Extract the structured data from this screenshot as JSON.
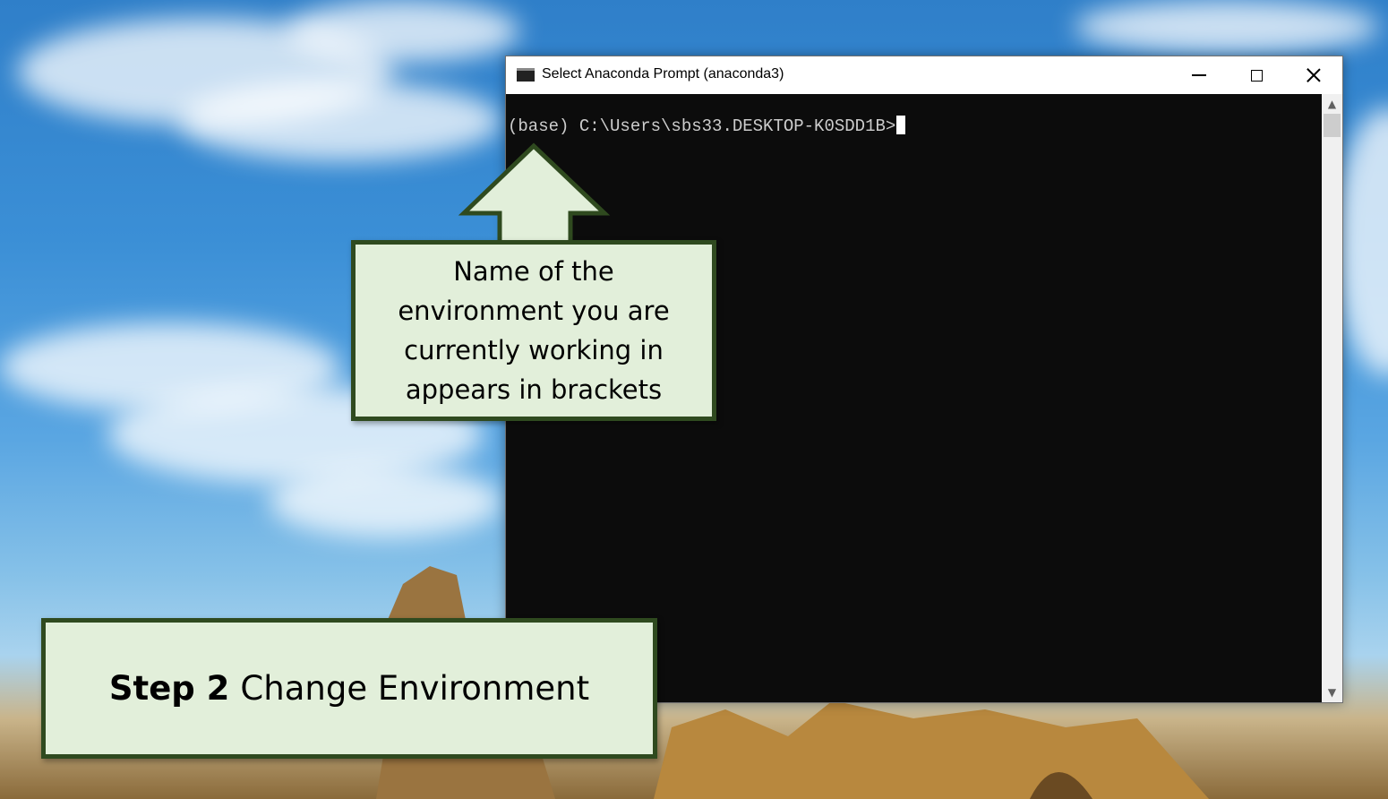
{
  "window": {
    "title": "Select Anaconda Prompt (anaconda3)",
    "icon": "console-icon",
    "controls": [
      "minimize-icon",
      "maximize-icon",
      "close-icon"
    ]
  },
  "console": {
    "prompt": "(base) C:\\Users\\sbs33.DESKTOP-K0SDD1B>"
  },
  "scrollbar": {
    "up_arrow": "▲",
    "down_arrow": "▼"
  },
  "callout": {
    "text": "Name of the environment you are currently working in appears in brackets"
  },
  "step": {
    "label": "Step 2",
    "text": "Change Environment"
  },
  "colors": {
    "callout_fill": "#e2efda",
    "callout_border": "#2f4a1f",
    "console_bg": "#0c0c0c",
    "console_text": "#cccccc"
  }
}
